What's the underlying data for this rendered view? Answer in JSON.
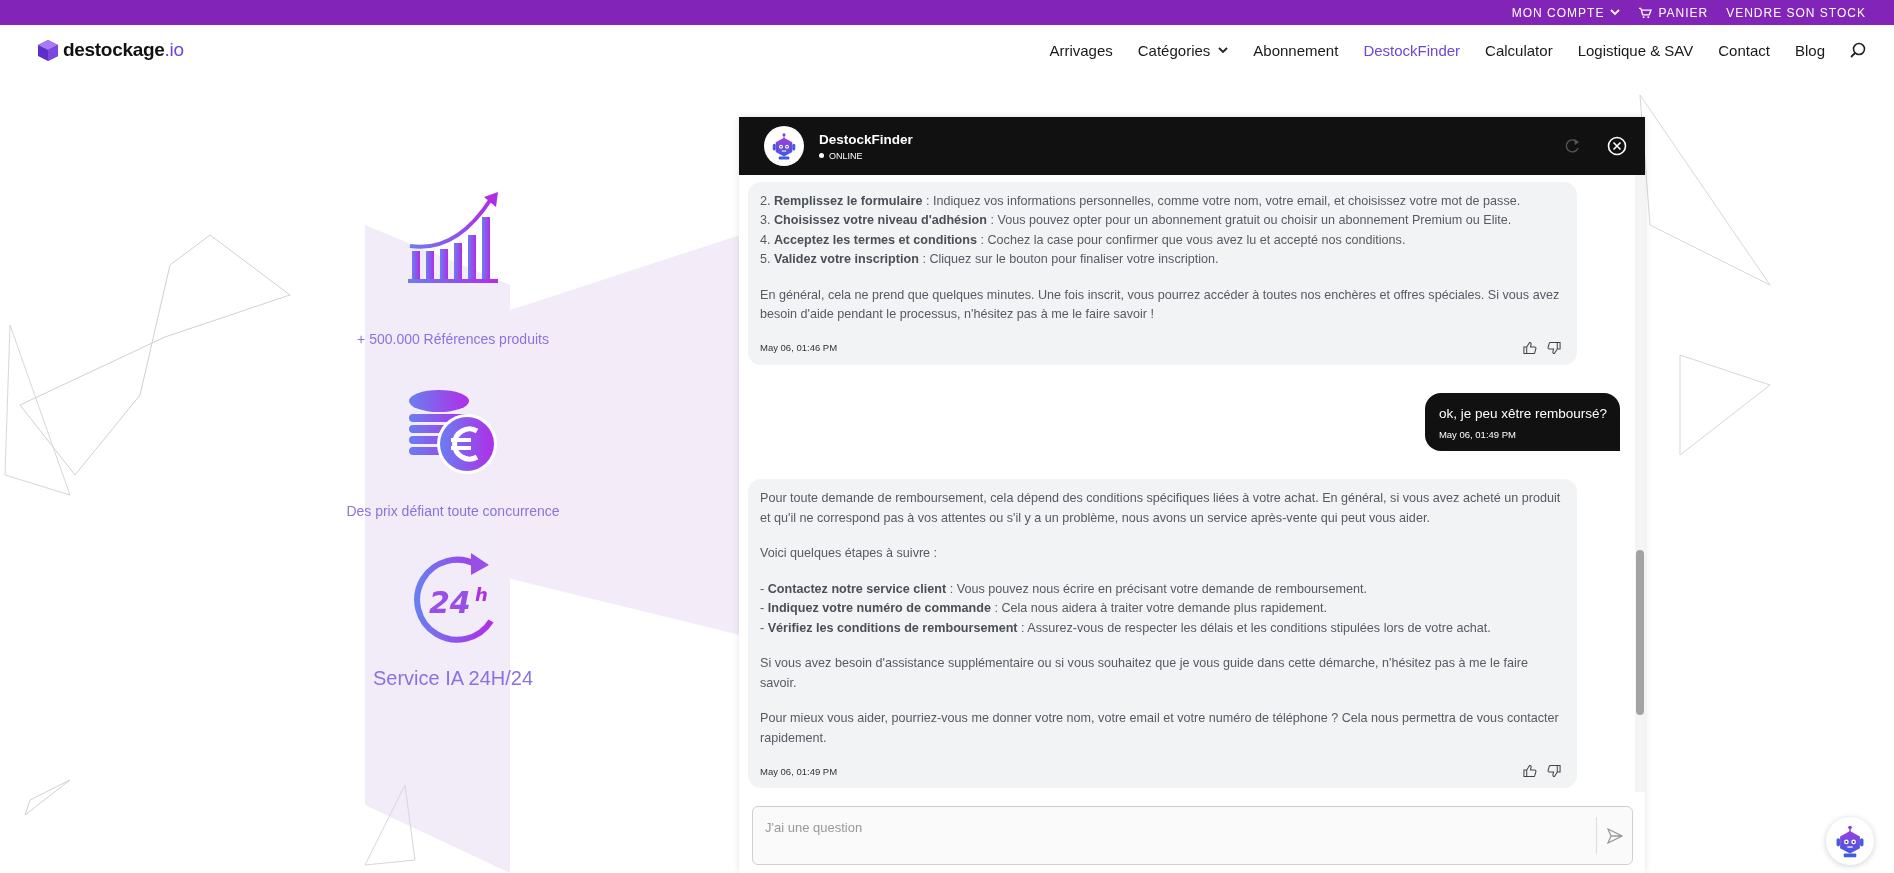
{
  "top_bar": {
    "links": [
      {
        "label": "MON COMPTE",
        "kind": "dropdown"
      },
      {
        "label": "PANIER",
        "kind": "cart"
      },
      {
        "label": "VENDRE SON STOCK",
        "kind": "plain"
      }
    ]
  },
  "navbar": {
    "logo": {
      "name": "destockage",
      "suffix": ".io"
    },
    "items": [
      {
        "label": "Arrivages",
        "selected": false,
        "dropdown": false
      },
      {
        "label": "Catégories",
        "selected": false,
        "dropdown": true
      },
      {
        "label": "Abonnement",
        "selected": false,
        "dropdown": false
      },
      {
        "label": "DestockFinder",
        "selected": true,
        "dropdown": false
      },
      {
        "label": "Calculator",
        "selected": false,
        "dropdown": false
      },
      {
        "label": "Logistique & SAV",
        "selected": false,
        "dropdown": false
      },
      {
        "label": "Contact",
        "selected": false,
        "dropdown": false
      },
      {
        "label": "Blog",
        "selected": false,
        "dropdown": false
      }
    ]
  },
  "features": [
    {
      "kind": "growth",
      "label": "+ 500.000 Références produits"
    },
    {
      "kind": "coins",
      "label": "Des prix défiant toute concurrence"
    },
    {
      "kind": "clock",
      "label": "Service IA 24H/24",
      "icon_text": [
        "24",
        "h"
      ]
    }
  ],
  "chat": {
    "title": "DestockFinder",
    "status": "ONLINE",
    "messages": [
      {
        "kind": "bot",
        "time": "May 06, 01:46 PM",
        "paragraphs": [
          [
            "2. **Remplissez le formulaire** : Indiquez vos informations personnelles, comme votre nom, votre email, et choisissez votre mot de passe.",
            "3. **Choisissez votre niveau d'adhésion** : Vous pouvez opter pour un abonnement gratuit ou choisir un abonnement Premium ou Elite.",
            "4. **Acceptez les termes et conditions** : Cochez la case pour confirmer que vous avez lu et accepté nos conditions.",
            "5. **Validez votre inscription** : Cliquez sur le bouton pour finaliser votre inscription."
          ],
          [
            "En général, cela ne prend que quelques minutes. Une fois inscrit, vous pourrez accéder à toutes nos enchères et offres spéciales. Si vous avez besoin d'aide pendant le processus, n'hésitez pas à me le faire savoir !"
          ]
        ]
      },
      {
        "kind": "user",
        "time": "May 06, 01:49 PM",
        "paragraphs": [
          [
            "ok, je peu xêtre remboursé?"
          ]
        ]
      },
      {
        "kind": "bot",
        "time": "May 06, 01:49 PM",
        "paragraphs": [
          [
            "Pour toute demande de remboursement, cela dépend des conditions spécifiques liées à votre achat. En général, si vous avez acheté un produit et qu'il ne correspond pas à vos attentes ou s'il y a un problème, nous avons un service après-vente qui peut vous aider."
          ],
          [
            "Voici quelques étapes à suivre :"
          ],
          [
            "- **Contactez notre service client** : Vous pouvez nous écrire en précisant votre demande de remboursement.",
            "- **Indiquez votre numéro de commande** : Cela nous aidera à traiter votre demande plus rapidement.",
            "- **Vérifiez les conditions de remboursement** : Assurez-vous de respecter les délais et les conditions stipulées lors de votre achat."
          ],
          [
            "Si vous avez besoin d'assistance supplémentaire ou si vous souhaitez que je vous guide dans cette démarche, n'hésitez pas à me le faire savoir."
          ],
          [
            "Pour mieux vous aider, pourriez-vous me donner votre nom, votre email et votre numéro de téléphone ? Cela nous permettra de vous contacter rapidement."
          ]
        ]
      }
    ],
    "input": {
      "placeholder": "J'ai une question"
    }
  }
}
